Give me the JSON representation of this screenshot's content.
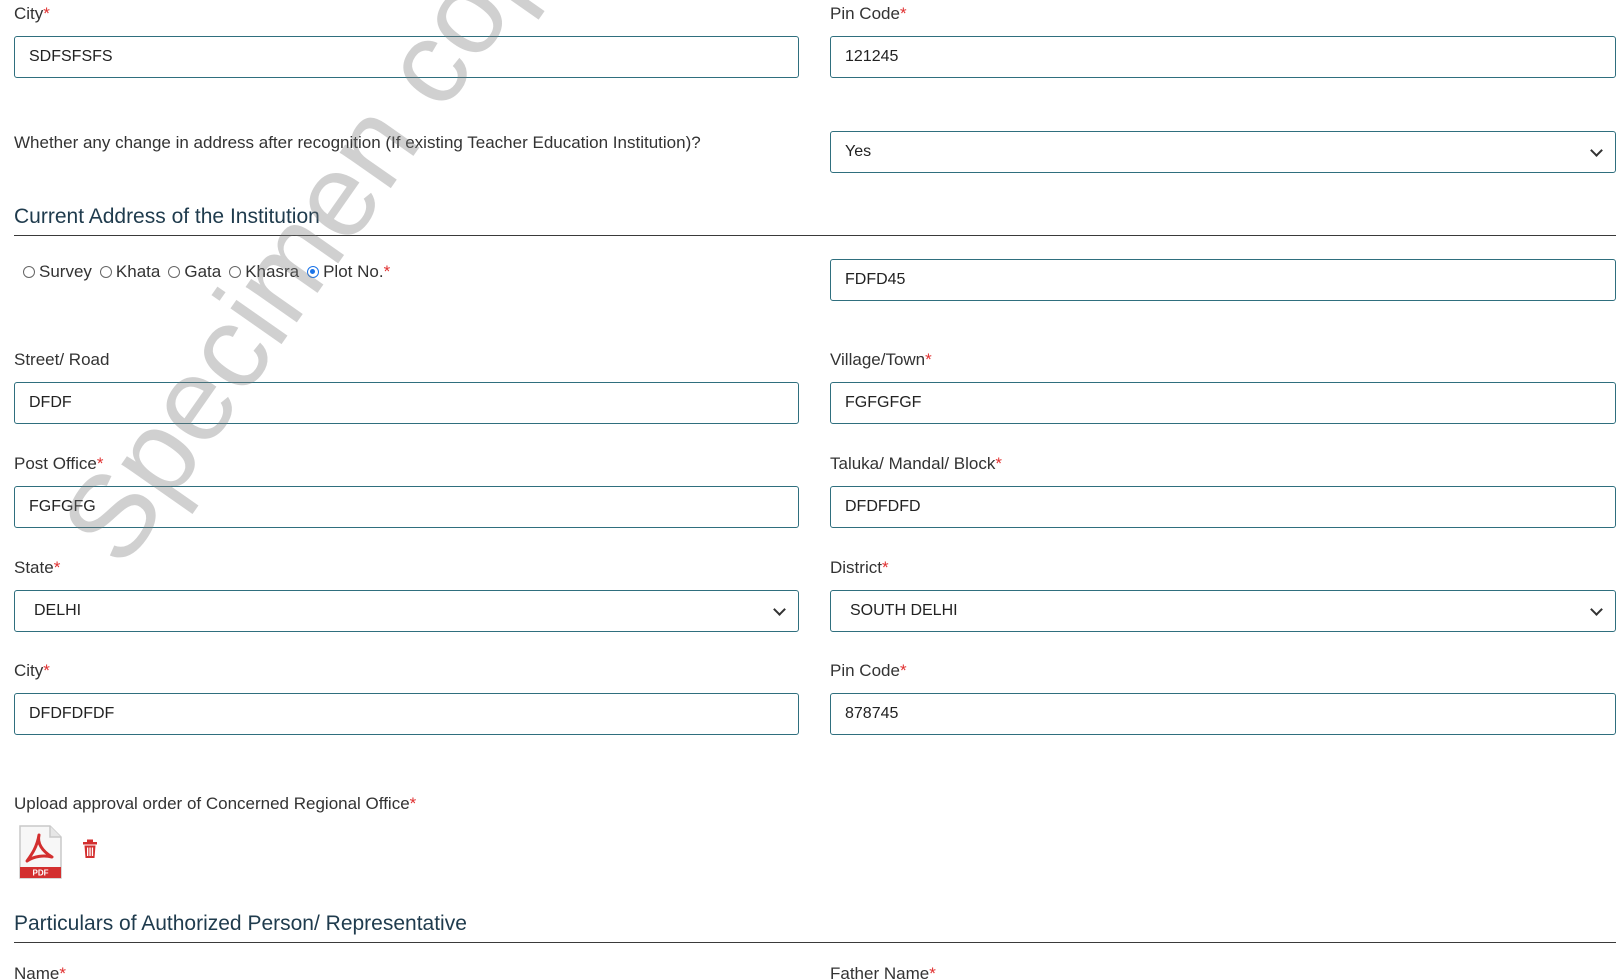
{
  "required_mark": "*",
  "top": {
    "city_label": "City",
    "city_value": "SDFSFSFS",
    "pin_label": "Pin Code",
    "pin_value": "121245"
  },
  "address_change": {
    "question": "Whether any change in address after recognition (If existing Teacher Education Institution)?",
    "selected": "Yes"
  },
  "current_address": {
    "title": "Current Address of the Institution",
    "land_types": [
      {
        "label": "Survey",
        "checked": false
      },
      {
        "label": "Khata",
        "checked": false
      },
      {
        "label": "Gata",
        "checked": false
      },
      {
        "label": "Khasra",
        "checked": false
      },
      {
        "label": "Plot No.",
        "checked": true
      }
    ],
    "plot_value": "FDFD45",
    "street_label": "Street/ Road",
    "street_value": "DFDF",
    "village_label": "Village/Town",
    "village_value": "FGFGFGF",
    "post_office_label": "Post Office",
    "post_office_value": "FGFGFG",
    "taluka_label": "Taluka/ Mandal/ Block",
    "taluka_value": "DFDFDFD",
    "state_label": "State",
    "state_value": "DELHI",
    "district_label": "District",
    "district_value": "SOUTH DELHI",
    "city_label": "City",
    "city_value": "DFDFDFDF",
    "pin_label": "Pin Code",
    "pin_value": "878745"
  },
  "upload": {
    "label": "Upload approval order of Concerned Regional Office",
    "file_icon": "pdf-file-icon",
    "pdf_badge": "PDF",
    "delete_icon": "trash-icon"
  },
  "authorized": {
    "title": "Particulars of Authorized Person/ Representative",
    "name_label": "Name",
    "father_label": "Father Name"
  },
  "watermark": "Specimen copy of ITEP",
  "colors": {
    "input_border": "#2f6f7e",
    "required": "#e03030",
    "pdf_red": "#d32f2f"
  }
}
